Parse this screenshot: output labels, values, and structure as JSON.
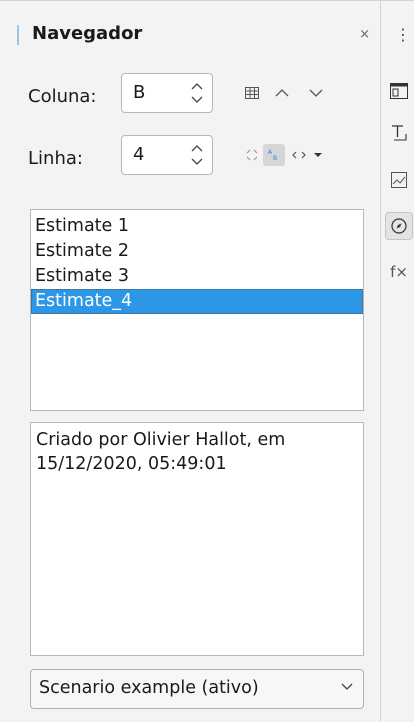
{
  "navigator": {
    "title": "Navegador",
    "close_glyph": "×",
    "column": {
      "label": "Coluna:",
      "value": "B"
    },
    "row": {
      "label": "Linha:",
      "value": "4"
    },
    "scenarios": [
      {
        "name": "Estimate 1",
        "selected": false
      },
      {
        "name": "Estimate 2",
        "selected": false
      },
      {
        "name": "Estimate 3",
        "selected": false
      },
      {
        "name": "Estimate_4",
        "selected": true
      }
    ],
    "comment": "Criado por Olivier Hallot, em 15/12/2020, 05:49:01",
    "document_select": {
      "value": "Scenario example (ativo)"
    }
  },
  "sidebar": {
    "more_glyph": "⋮",
    "tabs": [
      "properties-icon",
      "styles-icon",
      "gallery-icon",
      "navigator-icon",
      "functions-icon"
    ],
    "active_tab": "navigator-icon",
    "functions_glyph": "f×"
  },
  "colors": {
    "selection": "#2b97e6",
    "title_accent": "#9fc4e8"
  }
}
